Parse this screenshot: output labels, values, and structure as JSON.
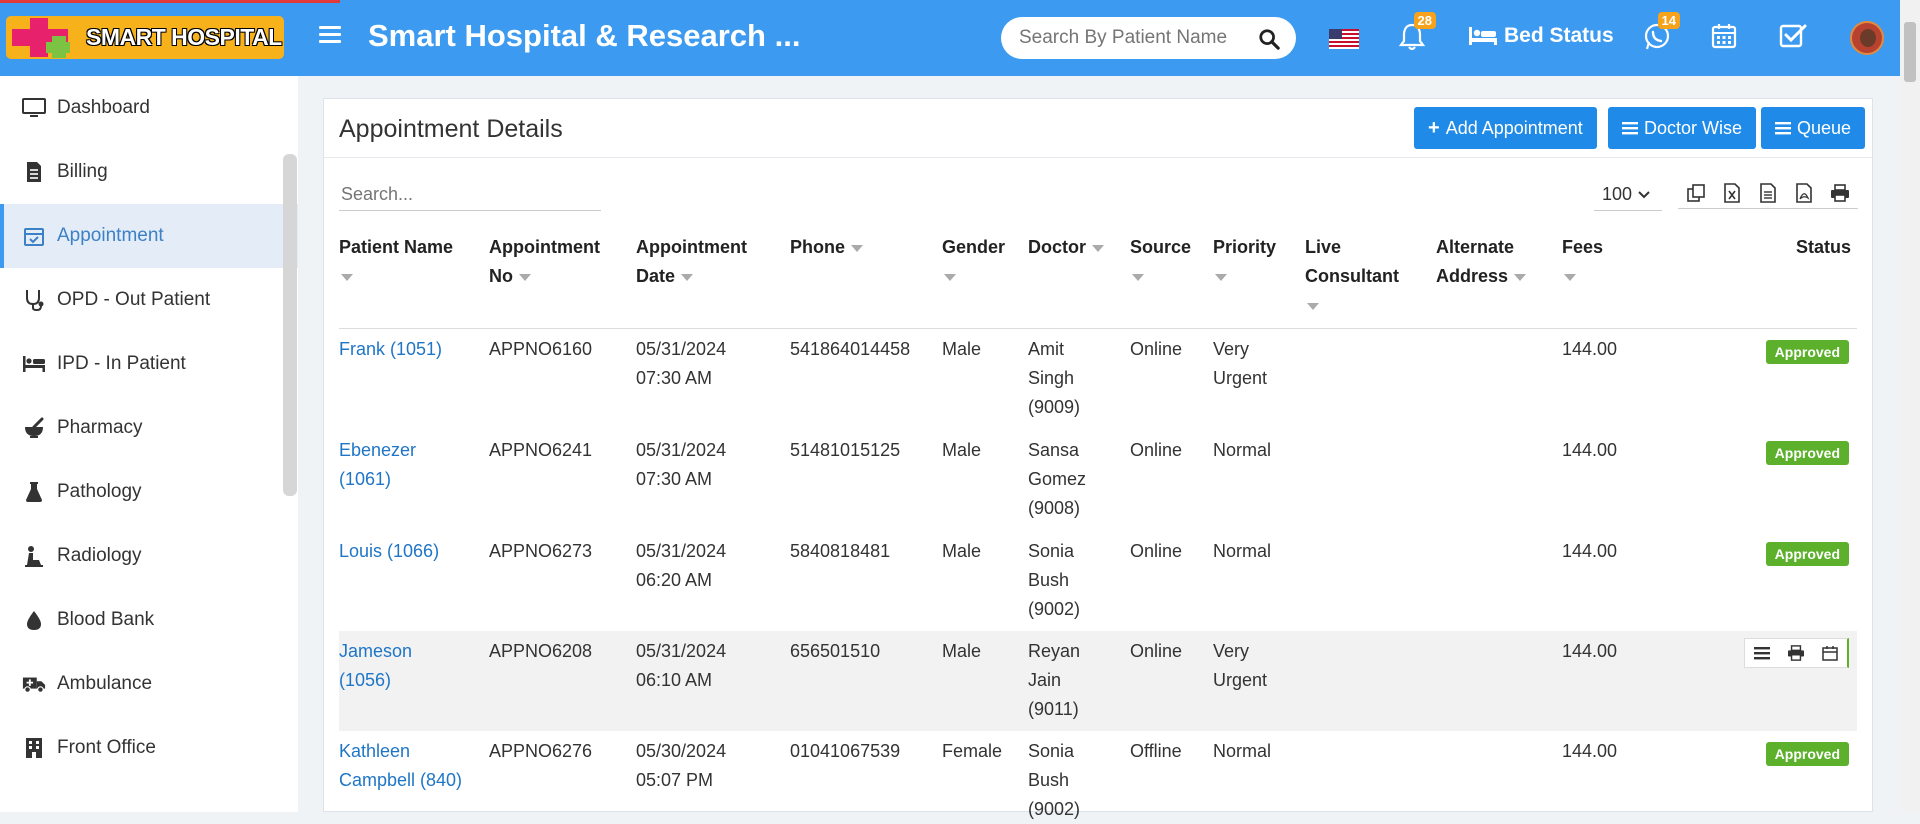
{
  "header": {
    "logo_text": "SMART HOSPITAL",
    "title": "Smart Hospital & Research ...",
    "search_placeholder": "Search By Patient Name",
    "notifications_count": "28",
    "bed_status_label": "Bed Status",
    "whatsapp_count": "14"
  },
  "sidebar": {
    "items": [
      {
        "label": "Dashboard",
        "icon": "monitor-icon"
      },
      {
        "label": "Billing",
        "icon": "billing-icon"
      },
      {
        "label": "Appointment",
        "icon": "calendar-check-icon"
      },
      {
        "label": "OPD - Out Patient",
        "icon": "stethoscope-icon"
      },
      {
        "label": "IPD - In Patient",
        "icon": "bed-icon"
      },
      {
        "label": "Pharmacy",
        "icon": "mortar-pestle-icon"
      },
      {
        "label": "Pathology",
        "icon": "flask-icon"
      },
      {
        "label": "Radiology",
        "icon": "xray-icon"
      },
      {
        "label": "Blood Bank",
        "icon": "blood-drop-icon"
      },
      {
        "label": "Ambulance",
        "icon": "ambulance-icon"
      },
      {
        "label": "Front Office",
        "icon": "building-icon"
      }
    ],
    "active": "Appointment"
  },
  "panel": {
    "title": "Appointment Details",
    "buttons": {
      "add": "Add Appointment",
      "doctor_wise": "Doctor Wise",
      "queue": "Queue"
    },
    "search_placeholder": "Search...",
    "page_size": "100"
  },
  "table": {
    "headers": {
      "patient": [
        "Patient Name",
        ""
      ],
      "appt_no": [
        "Appointment",
        "No"
      ],
      "appt_date": [
        "Appointment",
        "Date"
      ],
      "phone": [
        "Phone",
        ""
      ],
      "gender": [
        "Gender",
        ""
      ],
      "doctor": [
        "Doctor",
        ""
      ],
      "source": [
        "Source",
        ""
      ],
      "priority": [
        "Priority",
        ""
      ],
      "live": [
        "Live",
        "Consultant"
      ],
      "alt_addr": [
        "Alternate",
        "Address"
      ],
      "fees": [
        "Fees",
        ""
      ],
      "status": "Status"
    },
    "rows": [
      {
        "patient": [
          "Frank (1051)",
          ""
        ],
        "appt_no": "APPNO6160",
        "date": [
          "05/31/2024",
          "07:30 AM"
        ],
        "phone": "541864014458",
        "gender": "Male",
        "doctor": [
          "Amit",
          "Singh",
          "(9009)"
        ],
        "source": "Online",
        "priority": [
          "Very",
          "Urgent"
        ],
        "fees": "144.00",
        "status": "Approved"
      },
      {
        "patient": [
          "Ebenezer",
          "(1061)"
        ],
        "appt_no": "APPNO6241",
        "date": [
          "05/31/2024",
          "07:30 AM"
        ],
        "phone": "51481015125",
        "gender": "Male",
        "doctor": [
          "Sansa",
          "Gomez",
          "(9008)"
        ],
        "source": "Online",
        "priority": [
          "Normal",
          ""
        ],
        "fees": "144.00",
        "status": "Approved"
      },
      {
        "patient": [
          "Louis (1066)",
          ""
        ],
        "appt_no": "APPNO6273",
        "date": [
          "05/31/2024",
          "06:20 AM"
        ],
        "phone": "5840818481",
        "gender": "Male",
        "doctor": [
          "Sonia",
          "Bush",
          "(9002)"
        ],
        "source": "Online",
        "priority": [
          "Normal",
          ""
        ],
        "fees": "144.00",
        "status": "Approved"
      },
      {
        "patient": [
          "Jameson",
          "(1056)"
        ],
        "appt_no": "APPNO6208",
        "date": [
          "05/31/2024",
          "06:10 AM"
        ],
        "phone": "656501510",
        "gender": "Male",
        "doctor": [
          "Reyan",
          "Jain",
          "(9011)"
        ],
        "source": "Online",
        "priority": [
          "Very",
          "Urgent"
        ],
        "fees": "144.00",
        "status": ""
      },
      {
        "patient": [
          "Kathleen",
          "Campbell (840)"
        ],
        "appt_no": "APPNO6276",
        "date": [
          "05/30/2024",
          "05:07 PM"
        ],
        "phone": "01041067539",
        "gender": "Female",
        "doctor": [
          "Sonia",
          "Bush",
          "(9002)"
        ],
        "source": "Offline",
        "priority": [
          "Normal",
          ""
        ],
        "fees": "144.00",
        "status": "Approved"
      }
    ]
  },
  "colors": {
    "header_bg": "#3c9bf0",
    "button_bg": "#1f8ae8",
    "approved": "#5cb02c",
    "link": "#1f75c6"
  }
}
